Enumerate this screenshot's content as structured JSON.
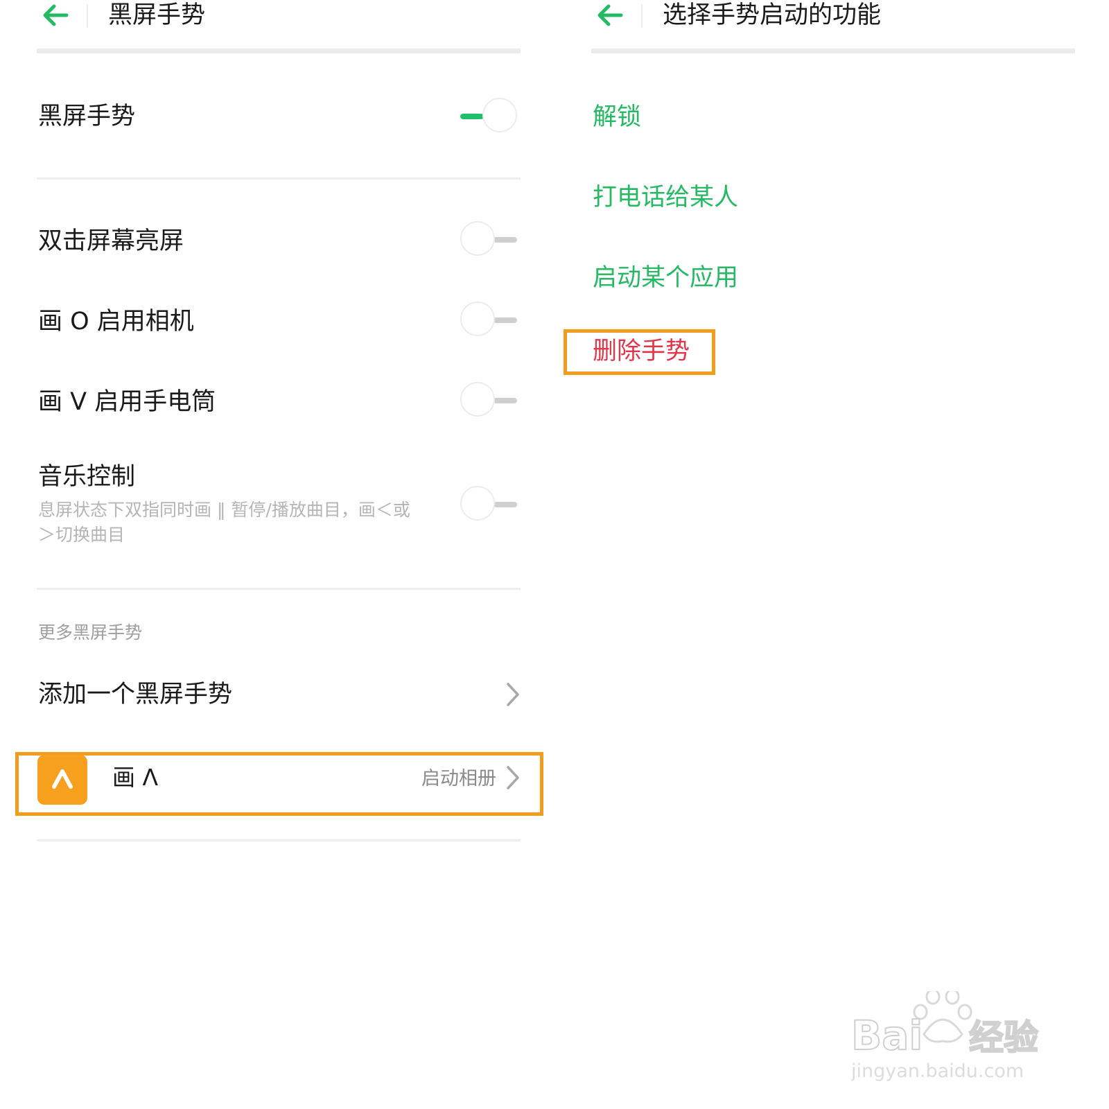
{
  "left_screen": {
    "title": "黑屏手势",
    "master_toggle": {
      "label": "黑屏手势",
      "on": true
    },
    "gesture_toggles": [
      {
        "label": "双击屏幕亮屏",
        "on": false
      },
      {
        "label": "画 O 启用相机",
        "on": false
      },
      {
        "label": "画 V 启用手电筒",
        "on": false
      }
    ],
    "music_control": {
      "label": "音乐控制",
      "description": "息屏状态下双指同时画 ‖ 暂停/播放曲目，画＜或＞切换曲目",
      "on": false
    },
    "more_section": {
      "header": "更多黑屏手势",
      "add_label": "添加一个黑屏手势"
    },
    "custom_gesture": {
      "icon_glyph": "Λ",
      "label": "画 Λ",
      "action": "启动相册",
      "highlighted": true
    }
  },
  "right_screen": {
    "title": "选择手势启动的功能",
    "options": [
      {
        "label": "解锁",
        "color": "#26b964"
      },
      {
        "label": "打电话给某人",
        "color": "#26b964"
      },
      {
        "label": "启动某个应用",
        "color": "#26b964"
      },
      {
        "label": "删除手势",
        "color": "#e0364b",
        "highlighted": true
      }
    ]
  },
  "watermark": {
    "brand": "Baidu经验",
    "url": "jingyan.baidu.com"
  },
  "colors": {
    "accent_green": "#26b964",
    "highlight_orange": "#f19c1c",
    "danger_red": "#e0364b"
  }
}
